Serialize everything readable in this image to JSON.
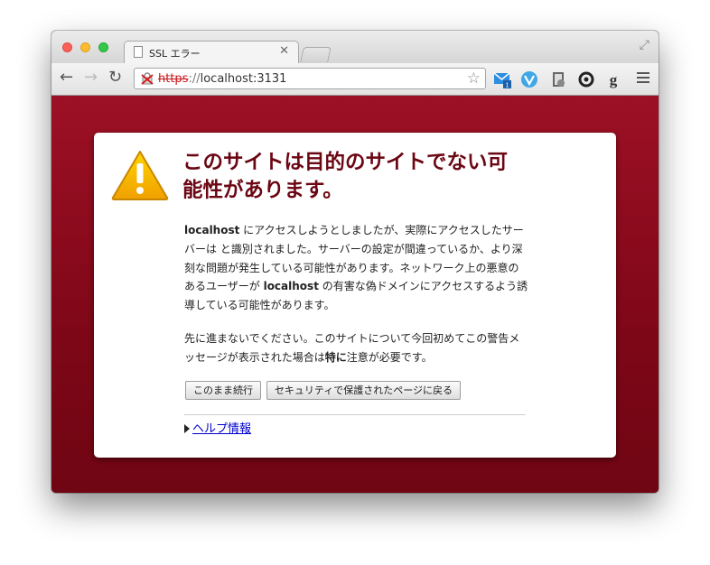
{
  "tab": {
    "title": "SSL エラー"
  },
  "omnibox": {
    "scheme": "https",
    "separator": "://",
    "host": "localhost:3131"
  },
  "extensions": [
    "mail-extension-icon",
    "v-extension-icon",
    "at-extension-icon",
    "sync-extension-icon",
    "g-extension-icon"
  ],
  "extension_badge": "1",
  "interstitial": {
    "headline": "このサイトは目的のサイトでない可能性があります。",
    "paragraph1": {
      "host1": "localhost",
      "text1": " にアクセスしようとしましたが、実際にアクセスしたサーバーは と識別されました。サーバーの設定が間違っているか、より深刻な問題が発生している可能性があります。ネットワーク上の悪意のあるユーザーが ",
      "host2": "localhost",
      "text2": " の有害な偽ドメインにアクセスするよう誘導している可能性があります。"
    },
    "paragraph2": {
      "before": "先に進まないでください。このサイトについて今回初めてこの警告メッセージが表示された場合は",
      "emphasis": "特に",
      "after": "注意が必要です。"
    },
    "proceed_button": "このまま続行",
    "back_button": "セキュリティで保護されたページに戻る",
    "help_link": "ヘルプ情報"
  },
  "colors": {
    "background": "#8b0c1f",
    "headline": "#6b0613",
    "scheme_error": "#c8141a",
    "warning": "#f5b800"
  }
}
